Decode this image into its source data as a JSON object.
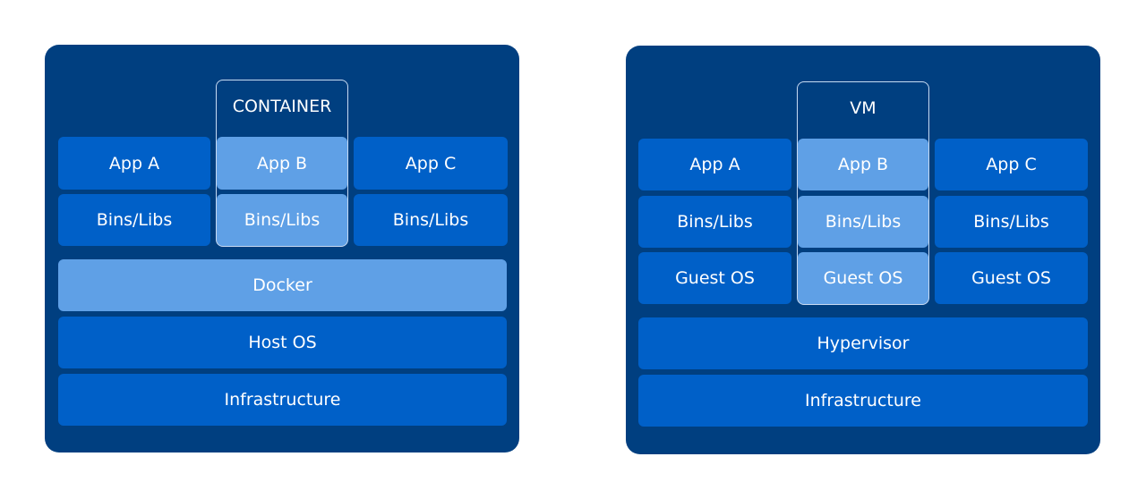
{
  "colors": {
    "panel": "#003f80",
    "block": "#0060c8",
    "highlight": "#5fa0e6",
    "text": "#ffffff"
  },
  "left": {
    "frame_label": "CONTAINER",
    "apps": [
      "App A",
      "App B",
      "App C"
    ],
    "libs": [
      "Bins/Libs",
      "Bins/Libs",
      "Bins/Libs"
    ],
    "layers": [
      "Docker",
      "Host OS",
      "Infrastructure"
    ]
  },
  "right": {
    "frame_label": "VM",
    "apps": [
      "App A",
      "App B",
      "App C"
    ],
    "libs": [
      "Bins/Libs",
      "Bins/Libs",
      "Bins/Libs"
    ],
    "guests": [
      "Guest OS",
      "Guest OS",
      "Guest OS"
    ],
    "layers": [
      "Hypervisor",
      "Infrastructure"
    ]
  }
}
